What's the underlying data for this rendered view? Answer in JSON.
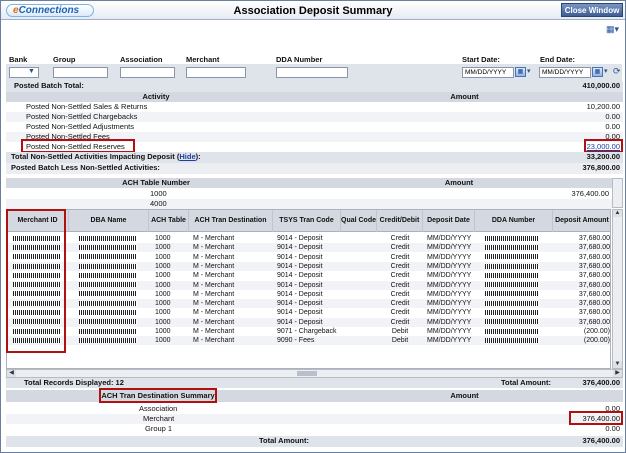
{
  "app": {
    "logo_e": "e",
    "logo_rest": "Connections",
    "title": "Association Deposit Summary",
    "close_label": "Close Window"
  },
  "filters": {
    "bank_label": "Bank",
    "group_label": "Group",
    "association_label": "Association",
    "merchant_label": "Merchant",
    "dda_label": "DDA Number",
    "start_label": "Start Date:",
    "end_label": "End Date:",
    "start_value": "MM/DD/YYYY",
    "end_value": "MM/DD/YYYY"
  },
  "batch": {
    "label": "Posted Batch Total:",
    "value": "410,000.00"
  },
  "activities": {
    "col_activity": "Activity",
    "col_amount": "Amount",
    "rows": [
      {
        "label": "Posted Non-Settled Sales & Returns",
        "amount": "10,200.00"
      },
      {
        "label": "Posted Non-Settled Chargebacks",
        "amount": "0.00"
      },
      {
        "label": "Posted Non-Settled Adjustments",
        "amount": "0.00"
      },
      {
        "label": "Posted Non-Settled Fees",
        "amount": "0.00"
      },
      {
        "label": "Posted Non-Settled Reserves",
        "amount": "23,000.00"
      }
    ],
    "total_label": "Total Non-Settled Activities Impacting Deposit (",
    "hide_link": "Hide",
    "total_label_end": "):",
    "total_value": "33,200.00",
    "less_label": "Posted Batch Less Non-Settled Activities:",
    "less_value": "376,800.00"
  },
  "ach_table": {
    "col_number": "ACH Table Number",
    "col_amount": "Amount",
    "rows": [
      {
        "number": "1000",
        "amount": "376,400.00"
      },
      {
        "number": "4000",
        "amount": ""
      }
    ]
  },
  "deposit_grid": {
    "headers": {
      "merchant": "Merchant ID",
      "dba": "DBA Name",
      "ach": "ACH Table",
      "dest": "ACH Tran Destination",
      "tsys": "TSYS Tran Code",
      "qual": "Qual Code",
      "cd": "Credit/Debit",
      "date": "Deposit Date",
      "dda": "DDA Number",
      "amount": "Deposit Amount"
    },
    "rows": [
      {
        "ach": "1000",
        "dest": "M - Merchant",
        "tsys": "9014 - Deposit",
        "cd": "Credit",
        "date": "MM/DD/YYYY",
        "amount": "37,680.00"
      },
      {
        "ach": "1000",
        "dest": "M - Merchant",
        "tsys": "9014 - Deposit",
        "cd": "Credit",
        "date": "MM/DD/YYYY",
        "amount": "37,680.00"
      },
      {
        "ach": "1000",
        "dest": "M - Merchant",
        "tsys": "9014 - Deposit",
        "cd": "Credit",
        "date": "MM/DD/YYYY",
        "amount": "37,680.00"
      },
      {
        "ach": "1000",
        "dest": "M - Merchant",
        "tsys": "9014 - Deposit",
        "cd": "Credit",
        "date": "MM/DD/YYYY",
        "amount": "37,680.00"
      },
      {
        "ach": "1000",
        "dest": "M - Merchant",
        "tsys": "9014 - Deposit",
        "cd": "Credit",
        "date": "MM/DD/YYYY",
        "amount": "37,680.00"
      },
      {
        "ach": "1000",
        "dest": "M - Merchant",
        "tsys": "9014 - Deposit",
        "cd": "Credit",
        "date": "MM/DD/YYYY",
        "amount": "37,680.00"
      },
      {
        "ach": "1000",
        "dest": "M - Merchant",
        "tsys": "9014 - Deposit",
        "cd": "Credit",
        "date": "MM/DD/YYYY",
        "amount": "37,680.00"
      },
      {
        "ach": "1000",
        "dest": "M - Merchant",
        "tsys": "9014 - Deposit",
        "cd": "Credit",
        "date": "MM/DD/YYYY",
        "amount": "37,680.00"
      },
      {
        "ach": "1000",
        "dest": "M - Merchant",
        "tsys": "9014 - Deposit",
        "cd": "Credit",
        "date": "MM/DD/YYYY",
        "amount": "37,680.00"
      },
      {
        "ach": "1000",
        "dest": "M - Merchant",
        "tsys": "9014 - Deposit",
        "cd": "Credit",
        "date": "MM/DD/YYYY",
        "amount": "37,680.00"
      },
      {
        "ach": "1000",
        "dest": "M - Merchant",
        "tsys": "9071 - Chargeback",
        "cd": "Debit",
        "date": "MM/DD/YYYY",
        "amount": "(200.00)"
      },
      {
        "ach": "1000",
        "dest": "M - Merchant",
        "tsys": "9090 - Fees",
        "cd": "Debit",
        "date": "MM/DD/YYYY",
        "amount": "(200.00)"
      }
    ]
  },
  "records": {
    "label": "Total Records Displayed: 12",
    "amount_label": "Total Amount:",
    "amount_value": "376,400.00"
  },
  "dest_summary": {
    "col_title": "ACH Tran Destination Summary",
    "col_amount": "Amount",
    "rows": [
      {
        "label": "Association",
        "amount": "0.00"
      },
      {
        "label": "Merchant",
        "amount": "376,400.00"
      },
      {
        "label": "Group 1",
        "amount": "0.00"
      }
    ],
    "total_label": "Total Amount:",
    "total_value": "376,400.00"
  }
}
